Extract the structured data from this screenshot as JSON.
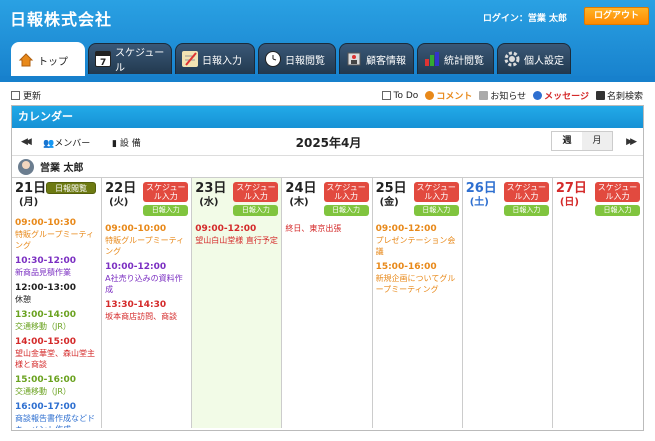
{
  "company": "日報株式会社",
  "login_label": "ログイン：営業 太郎",
  "logout": "ログアウト",
  "tabs": [
    {
      "label": "トップ",
      "icon": "home-icon"
    },
    {
      "label": "スケジュール",
      "icon": "calendar-icon"
    },
    {
      "label": "日報入力",
      "icon": "notepad-icon"
    },
    {
      "label": "日報閲覧",
      "icon": "clock-icon"
    },
    {
      "label": "顧客情報",
      "icon": "customer-icon"
    },
    {
      "label": "統計閲覧",
      "icon": "chart-icon"
    },
    {
      "label": "個人設定",
      "icon": "gear-icon"
    }
  ],
  "util": {
    "refresh": "更新",
    "todo": "To Do",
    "comment": "コメント",
    "notice": "お知らせ",
    "message": "メッセージ",
    "cardsearch": "名刺検索"
  },
  "calendar": {
    "title": "カレンダー",
    "member": "メンバー",
    "equipment": "設 備",
    "month": "2025年4月",
    "week": "週",
    "monthview": "月",
    "user": "営業 太郎"
  },
  "buttons": {
    "schedule": "スケジュール入力",
    "report_in": "日報入力",
    "report_view": "日報閲覧"
  },
  "colors": {
    "orange": "#e8891a",
    "purple": "#7b2fc2",
    "black": "#222222",
    "green": "#6aa21f",
    "red": "#d42a2a",
    "blue": "#2e6fd0"
  },
  "days": [
    {
      "num": "21日",
      "wd": "(月)",
      "color": "#222222",
      "events": [
        {
          "time": "09:00-10:30",
          "desc": "特販グループミーティング",
          "color": "#e8891a"
        },
        {
          "time": "10:30-12:00",
          "desc": "新商品見積作業",
          "color": "#7b2fc2"
        },
        {
          "time": "12:00-13:00",
          "desc": "休憩",
          "color": "#222222"
        },
        {
          "time": "13:00-14:00",
          "desc": "交通移動（JR）",
          "color": "#6aa21f"
        },
        {
          "time": "14:00-15:00",
          "desc": "望山金華堂、森山堂主様と商談",
          "color": "#d42a2a"
        },
        {
          "time": "15:00-16:00",
          "desc": "交通移動（JR）",
          "color": "#6aa21f"
        },
        {
          "time": "16:00-17:00",
          "desc": "商談報告書作成などドキュメント作成",
          "color": "#2e6fd0"
        }
      ]
    },
    {
      "num": "22日",
      "wd": "(火)",
      "color": "#222222",
      "events": [
        {
          "time": "09:00-10:00",
          "desc": "特販グループミーティング",
          "color": "#e8891a"
        },
        {
          "time": "10:00-12:00",
          "desc": "A社売り込みの資料作成",
          "color": "#7b2fc2"
        },
        {
          "time": "13:30-14:30",
          "desc": "坂本商店訪問、商談",
          "color": "#d42a2a"
        }
      ]
    },
    {
      "num": "23日",
      "wd": "(水)",
      "color": "#222222",
      "events": [
        {
          "time": "09:00-12:00",
          "desc": "望山白山堂様 直行予定",
          "color": "#d42a2a"
        }
      ]
    },
    {
      "num": "24日",
      "wd": "(木)",
      "color": "#222222",
      "events": [
        {
          "time": "",
          "desc": "終日、東京出張",
          "color": "#d42a2a"
        }
      ]
    },
    {
      "num": "25日",
      "wd": "(金)",
      "color": "#222222",
      "events": [
        {
          "time": "09:00-12:00",
          "desc": "プレゼンテーション会議",
          "color": "#e8891a"
        },
        {
          "time": "15:00-16:00",
          "desc": "新規企画についてグループミーティング",
          "color": "#e8891a"
        }
      ]
    },
    {
      "num": "26日",
      "wd": "(土)",
      "color": "#2e6fd0",
      "events": []
    },
    {
      "num": "27日",
      "wd": "(日)",
      "color": "#d42a2a",
      "events": []
    }
  ]
}
